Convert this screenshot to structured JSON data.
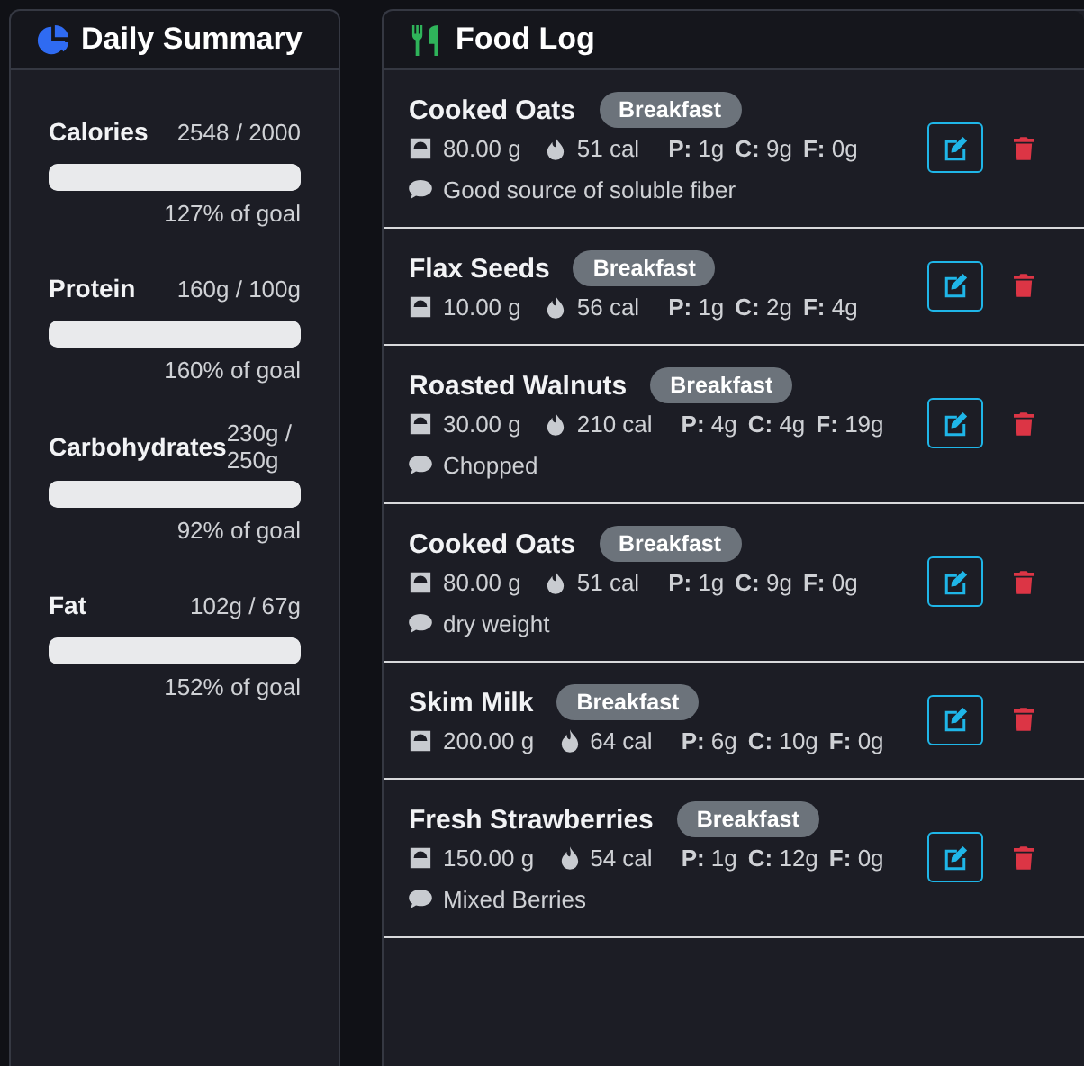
{
  "summary": {
    "title": "Daily Summary",
    "metrics": [
      {
        "name": "Calories",
        "reading": "2548 / 2000",
        "level": 1,
        "percent": "127% of goal"
      },
      {
        "name": "Protein",
        "reading": "160g / 100g",
        "level": 1,
        "percent": "160% of goal"
      },
      {
        "name": "Carbohydrates",
        "reading": "230g / 250g",
        "level": 1,
        "percent": "92% of goal"
      },
      {
        "name": "Fat",
        "reading": "102g / 67g",
        "level": 1,
        "percent": "152% of goal"
      }
    ]
  },
  "food_log": {
    "title": "Food Log",
    "entries": [
      {
        "name": "Cooked Oats",
        "meal": "Breakfast",
        "weight": "80.00 g",
        "calories": "51 cal",
        "macros": [
          "**P:** 1g",
          "**C:** 9g",
          "**F:** 0g"
        ],
        "note": "Good source of soluble fiber"
      },
      {
        "name": "Flax Seeds",
        "meal": "Breakfast",
        "weight": "10.00 g",
        "calories": "56 cal",
        "macros": [
          "**P:** 1g",
          "**C:** 2g",
          "**F:** 4g"
        ]
      },
      {
        "name": "Roasted Walnuts",
        "meal": "Breakfast",
        "weight": "30.00 g",
        "calories": "210 cal",
        "macros": [
          "**P:** 4g",
          "**C:** 4g",
          "**F:** 19g"
        ],
        "note": "Chopped"
      },
      {
        "name": "Cooked Oats",
        "meal": "Breakfast",
        "weight": "80.00 g",
        "calories": "51 cal",
        "macros": [
          "**P:** 1g",
          "**C:** 9g",
          "**F:** 0g"
        ],
        "note": "dry weight"
      },
      {
        "name": "Skim Milk",
        "meal": "Breakfast",
        "weight": "200.00 g",
        "calories": "64 cal",
        "macros": [
          "**P:** 6g",
          "**C:** 10g",
          "**F:** 0g"
        ]
      },
      {
        "name": "Fresh Strawberries",
        "meal": "Breakfast",
        "weight": "150.00 g",
        "calories": "54 cal",
        "macros": [
          "**P:** 1g",
          "**C:** 12g",
          "**F:** 0g"
        ],
        "note": "Mixed Berries"
      }
    ]
  }
}
